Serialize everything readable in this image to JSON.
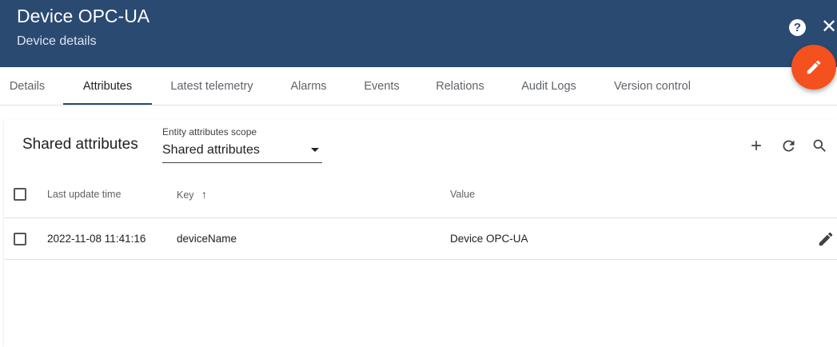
{
  "header": {
    "title": "Device OPC-UA",
    "subtitle": "Device details",
    "help_label": "?",
    "close_label": "✕"
  },
  "tabs": [
    {
      "label": "Details"
    },
    {
      "label": "Attributes",
      "active": true
    },
    {
      "label": "Latest telemetry"
    },
    {
      "label": "Alarms"
    },
    {
      "label": "Events"
    },
    {
      "label": "Relations"
    },
    {
      "label": "Audit Logs"
    },
    {
      "label": "Version control"
    }
  ],
  "panel": {
    "title": "Shared attributes",
    "scope_label": "Entity attributes scope",
    "scope_value": "Shared attributes"
  },
  "table": {
    "columns": {
      "last_update": "Last update time",
      "key": "Key",
      "key_sort": "↑",
      "value": "Value"
    },
    "rows": [
      {
        "last_update": "2022-11-08 11:41:16",
        "key": "deviceName",
        "value": "Device OPC-UA"
      }
    ]
  },
  "icons": {
    "fab": "edit-icon",
    "add": "add-icon",
    "refresh": "refresh-icon",
    "search": "search-icon",
    "row_edit": "edit-icon"
  },
  "colors": {
    "header": "#2a4a72",
    "fab": "#f4511e"
  }
}
